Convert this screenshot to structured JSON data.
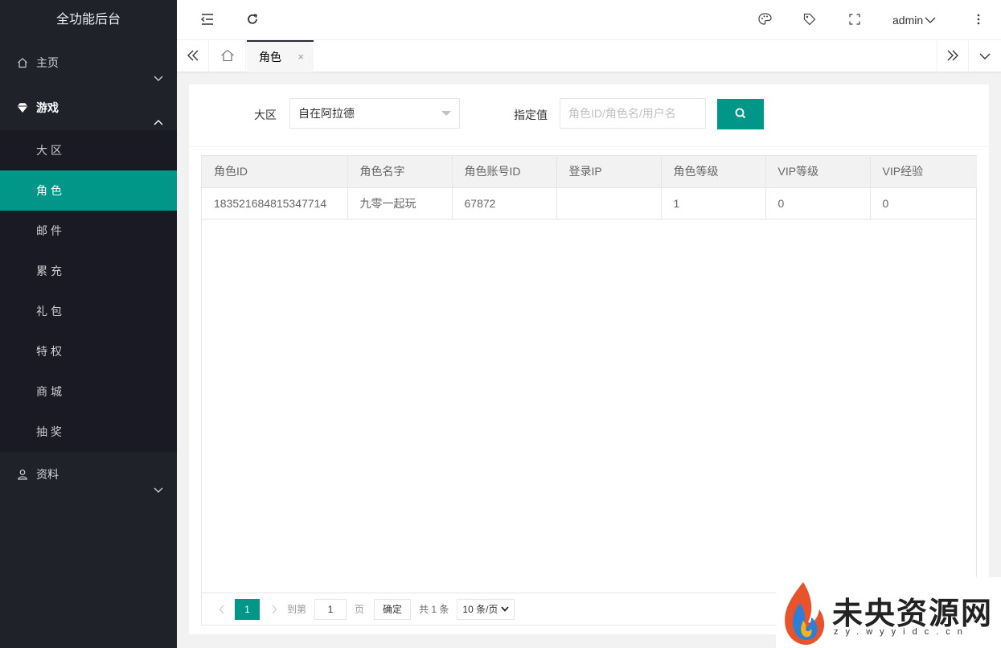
{
  "app": {
    "title": "全功能后台"
  },
  "sidebar": {
    "items": [
      {
        "label": "主页",
        "icon": "home-icon"
      },
      {
        "label": "游戏",
        "icon": "diamond-icon"
      },
      {
        "label": "资料",
        "icon": "user-icon"
      }
    ],
    "game_sub": [
      "大区",
      "角色",
      "邮件",
      "累充",
      "礼包",
      "特权",
      "商城",
      "抽奖"
    ],
    "selected": "角色"
  },
  "header": {
    "user": "admin"
  },
  "tabs": [
    {
      "label": "角色",
      "close": "×"
    }
  ],
  "filter": {
    "region_label": "大区",
    "region_value": "自在阿拉德",
    "value_label": "指定值",
    "value_placeholder": "角色ID/角色名/用户名",
    "value_value": ""
  },
  "table": {
    "headers": [
      "角色ID",
      "角色名字",
      "角色账号ID",
      "登录IP",
      "角色等级",
      "VIP等级",
      "VIP经验"
    ],
    "rows": [
      [
        "183521684815347714",
        "九零一起玩",
        "67872",
        "",
        "1",
        "0",
        "0"
      ]
    ]
  },
  "pager": {
    "current": "1",
    "goto_label": "到第",
    "goto_value": "1",
    "page_unit": "页",
    "confirm": "确定",
    "total": "共 1 条",
    "page_size": "10 条/页"
  },
  "watermark": {
    "title": "未央资源网",
    "sub": "zy.wyyidc.cn"
  },
  "colors": {
    "accent": "#009688",
    "sidebar": "#20222a",
    "subnav": "#191a23"
  }
}
